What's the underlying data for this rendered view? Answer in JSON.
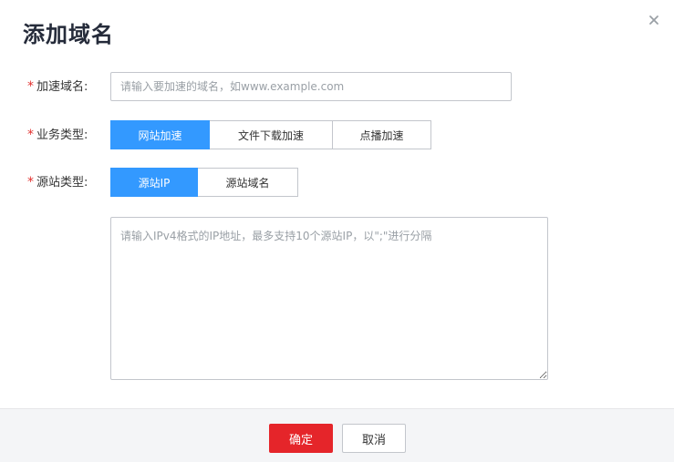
{
  "dialog": {
    "title": "添加域名"
  },
  "form": {
    "domain": {
      "required_mark": "*",
      "label": "加速域名:",
      "value": "",
      "placeholder": "请输入要加速的域名，如www.example.com"
    },
    "business_type": {
      "required_mark": "*",
      "label": "业务类型:",
      "options": [
        "网站加速",
        "文件下载加速",
        "点播加速"
      ],
      "selected": "网站加速"
    },
    "origin_type": {
      "required_mark": "*",
      "label": "源站类型:",
      "options": [
        "源站IP",
        "源站域名"
      ],
      "selected": "源站IP"
    },
    "origin_ip": {
      "value": "",
      "placeholder": "请输入IPv4格式的IP地址，最多支持10个源站IP，以\";\"进行分隔"
    }
  },
  "footer": {
    "ok_label": "确定",
    "cancel_label": "取消"
  },
  "colors": {
    "primary_blue": "#3399ff",
    "confirm_red": "#e5252a",
    "required_red": "#e2312f"
  },
  "icons": {
    "close": "close-icon"
  }
}
